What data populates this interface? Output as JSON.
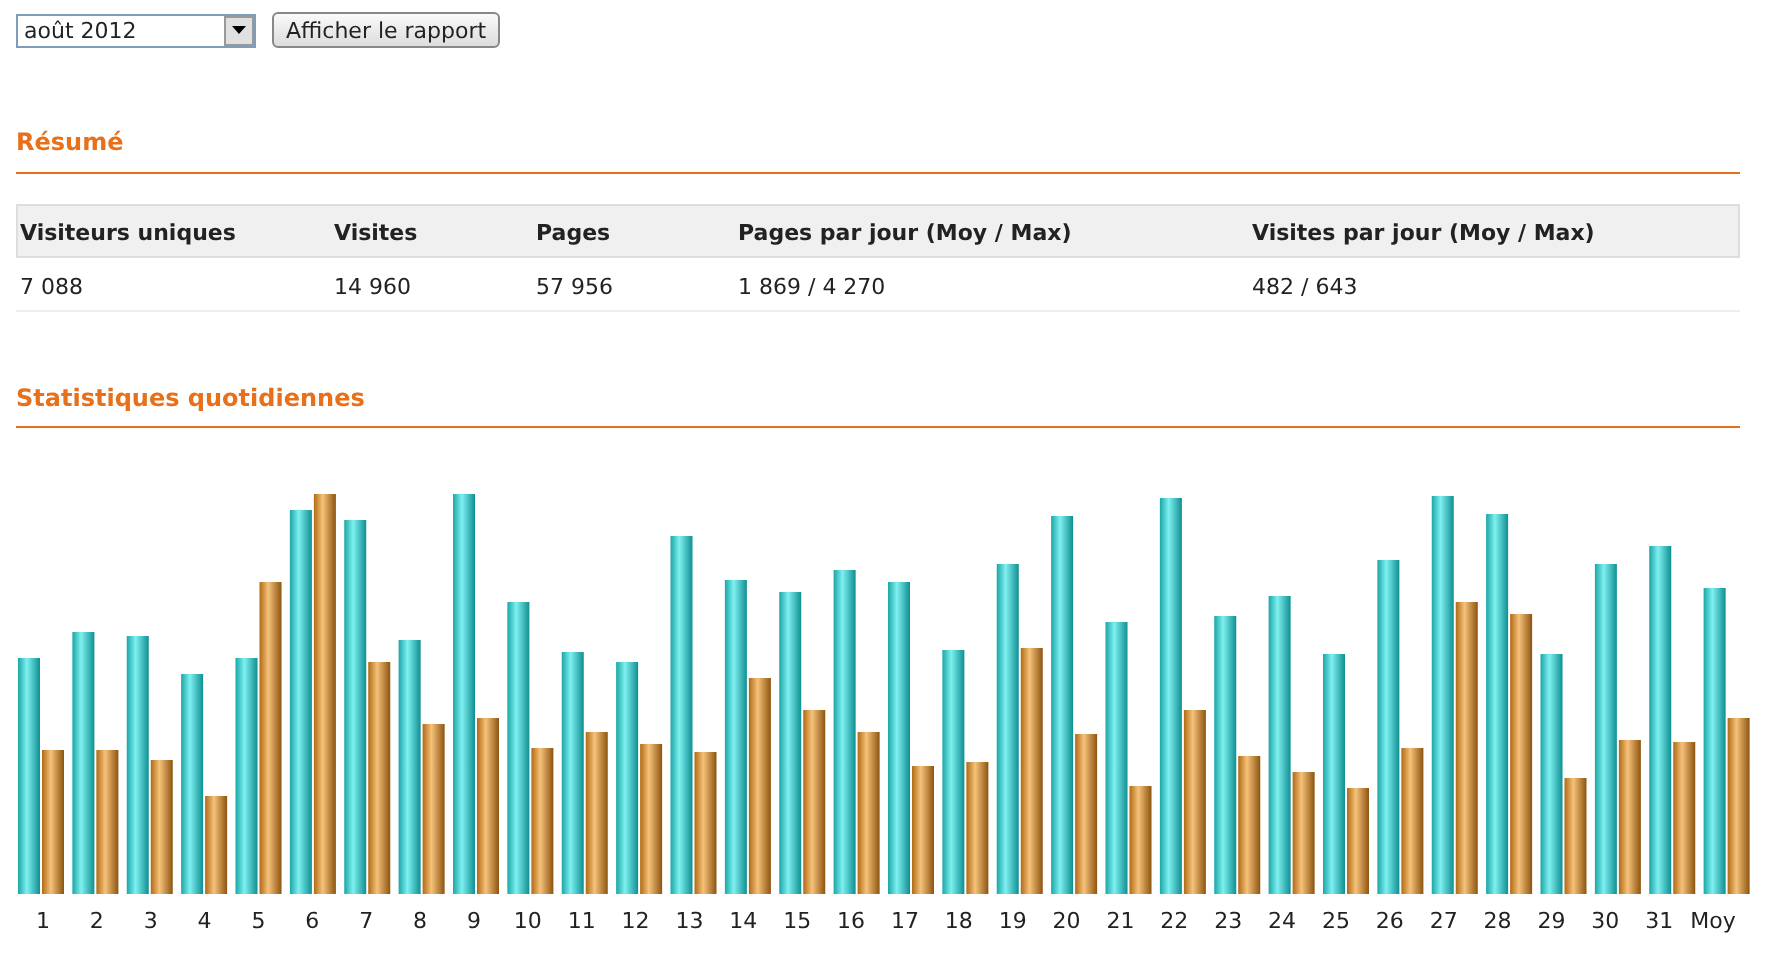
{
  "period_select": {
    "value": "août 2012"
  },
  "report_button": {
    "label": "Afficher le rapport"
  },
  "summary": {
    "title": "Résumé",
    "columns": [
      "Visiteurs uniques",
      "Visites",
      "Pages",
      "Pages par jour (Moy / Max)",
      "Visites par jour (Moy / Max)"
    ],
    "rows": [
      [
        "7 088",
        "14 960",
        "57 956",
        "1 869 / 4 270",
        "482 / 643"
      ]
    ]
  },
  "daily_stats": {
    "title": "Statistiques quotidiennes",
    "x_labels": [
      "1",
      "2",
      "3",
      "4",
      "5",
      "6",
      "7",
      "8",
      "9",
      "10",
      "11",
      "12",
      "13",
      "14",
      "15",
      "16",
      "17",
      "18",
      "19",
      "20",
      "21",
      "22",
      "23",
      "24",
      "25",
      "26",
      "27",
      "28",
      "29",
      "30",
      "31",
      "Moy"
    ]
  }
}
